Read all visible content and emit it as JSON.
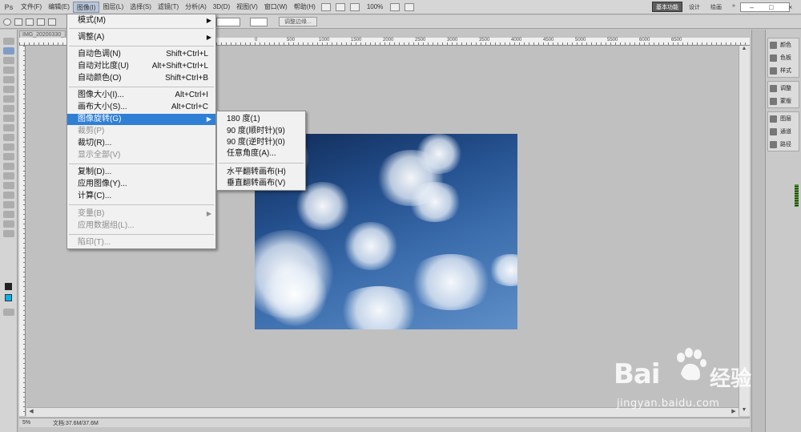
{
  "app": {
    "logo": "Ps"
  },
  "menubar": {
    "items": [
      "文件(F)",
      "编辑(E)",
      "图像(I)",
      "图层(L)",
      "选择(S)",
      "滤镜(T)",
      "分析(A)",
      "3D(D)",
      "视图(V)",
      "窗口(W)",
      "帮助(H)"
    ],
    "zoom": "100%",
    "workspace": "基本功能",
    "workspace_items": [
      "设计",
      "绘画"
    ],
    "window_controls": [
      "–",
      "□",
      "×"
    ]
  },
  "options": {
    "label": "调整边缘..."
  },
  "document": {
    "tab": "IMG_20200330_15",
    "ruler_numbers": [
      "500",
      "0",
      "500",
      "1000",
      "1500",
      "2000",
      "2500",
      "3000",
      "3500",
      "4000",
      "4500",
      "5000",
      "5500",
      "6000",
      "6500"
    ],
    "status_zoom": "5%",
    "status_doc": "文档:37.6M/37.6M"
  },
  "image_menu": {
    "items": [
      {
        "label": "模式(M)",
        "shortcut": "",
        "submenu": true,
        "disabled": false
      },
      {
        "label": "调整(A)",
        "shortcut": "",
        "submenu": true,
        "disabled": false
      },
      {
        "label": "自动色调(N)",
        "shortcut": "Shift+Ctrl+L",
        "submenu": false,
        "disabled": false
      },
      {
        "label": "自动对比度(U)",
        "shortcut": "Alt+Shift+Ctrl+L",
        "submenu": false,
        "disabled": false
      },
      {
        "label": "自动颜色(O)",
        "shortcut": "Shift+Ctrl+B",
        "submenu": false,
        "disabled": false
      },
      {
        "label": "图像大小(I)...",
        "shortcut": "Alt+Ctrl+I",
        "submenu": false,
        "disabled": false
      },
      {
        "label": "画布大小(S)...",
        "shortcut": "Alt+Ctrl+C",
        "submenu": false,
        "disabled": false
      },
      {
        "label": "图像旋转(G)",
        "shortcut": "",
        "submenu": true,
        "disabled": false,
        "highlighted": true
      },
      {
        "label": "裁剪(P)",
        "shortcut": "",
        "submenu": false,
        "disabled": true
      },
      {
        "label": "裁切(R)...",
        "shortcut": "",
        "submenu": false,
        "disabled": false
      },
      {
        "label": "显示全部(V)",
        "shortcut": "",
        "submenu": false,
        "disabled": true
      },
      {
        "label": "复制(D)...",
        "shortcut": "",
        "submenu": false,
        "disabled": false
      },
      {
        "label": "应用图像(Y)...",
        "shortcut": "",
        "submenu": false,
        "disabled": false
      },
      {
        "label": "计算(C)...",
        "shortcut": "",
        "submenu": false,
        "disabled": false
      },
      {
        "label": "变量(B)",
        "shortcut": "",
        "submenu": true,
        "disabled": true
      },
      {
        "label": "应用数据组(L)...",
        "shortcut": "",
        "submenu": false,
        "disabled": true
      },
      {
        "label": "陷印(T)...",
        "shortcut": "",
        "submenu": false,
        "disabled": true
      }
    ]
  },
  "rotation_submenu": {
    "items": [
      "180 度(1)",
      "90 度(顺时针)(9)",
      "90 度(逆时针)(0)",
      "任意角度(A)...",
      "水平翻转画布(H)",
      "垂直翻转画布(V)"
    ]
  },
  "right_panel": {
    "group1": [
      "颜色",
      "色板",
      "样式"
    ],
    "group2": [
      "调整",
      "蒙版"
    ],
    "group3": [
      "图层",
      "通道",
      "路径"
    ]
  },
  "colors": {
    "menu_highlight": "#2f7fd5",
    "foreground": "#00b4f0",
    "ui_bg": "#c4c4c4"
  },
  "watermark": {
    "brand": "Bai",
    "cn": "经验",
    "url": "jingyan.baidu.com"
  }
}
